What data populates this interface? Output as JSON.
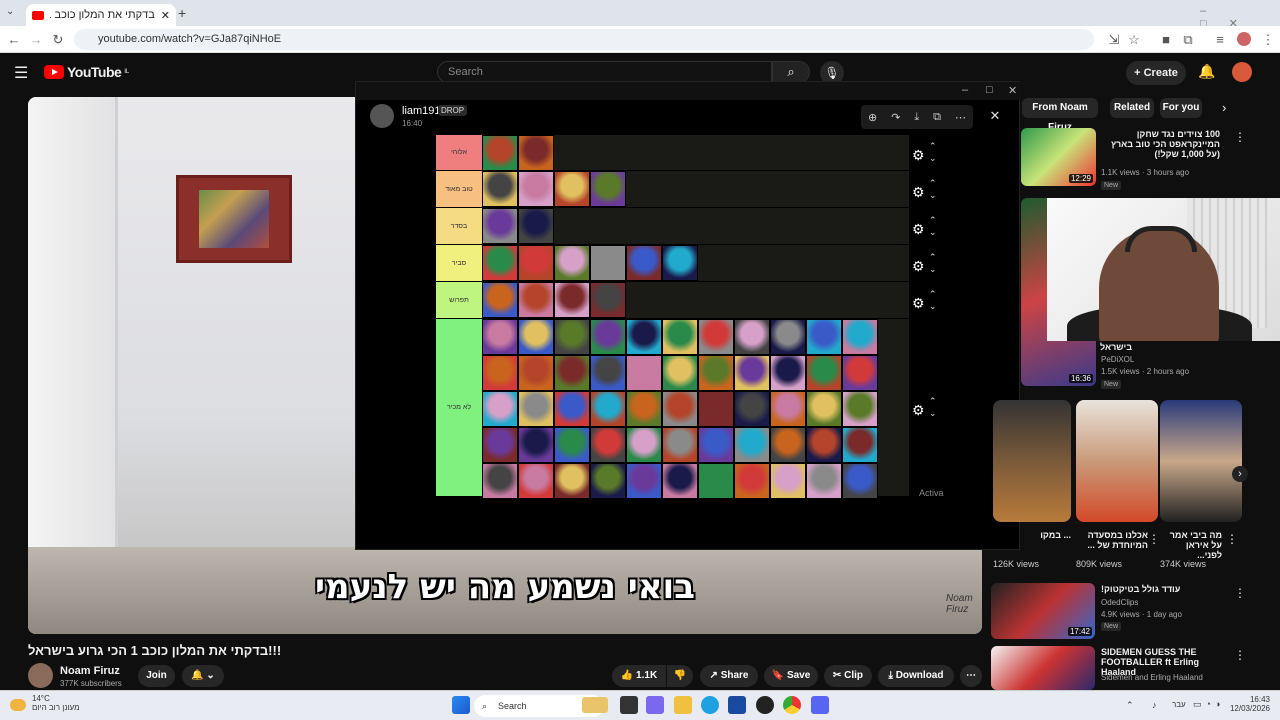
{
  "browser": {
    "tab_title": "בדקתי את המלון כוכב 1 הכי...",
    "url": "youtube.com/watch?v=GJa87qiNHoE"
  },
  "youtube": {
    "logo_text": "YouTube",
    "logo_region": "IL",
    "search_placeholder": "Search",
    "create_label": "Create"
  },
  "video": {
    "subtitle": "בואי נשמע מה יש לנעמי",
    "signature": "Noam Firuz",
    "title": "!!!בדקתי את המלון כוכב 1 הכי גרוע בישראל"
  },
  "channel": {
    "name": "Noam Firuz",
    "subscribers": "377K subscribers",
    "join_label": "Join"
  },
  "actions": {
    "likes": "1.1K",
    "share": "Share",
    "save": "Save",
    "clip": "Clip",
    "download": "Download"
  },
  "discord": {
    "username": "liam191",
    "badge": "DROP",
    "time": "16:40",
    "activation_text": "Activa"
  },
  "tiers": [
    {
      "label": "אלוהי",
      "color": "#ef7f7f",
      "count": 2
    },
    {
      "label": "טוב מאוד",
      "color": "#f7bf80",
      "count": 4
    },
    {
      "label": "בסדר",
      "color": "#f5dc82",
      "count": 2
    },
    {
      "label": "סביר",
      "color": "#f0f07f",
      "count": 6
    },
    {
      "label": "תפרוש",
      "color": "#bef57f",
      "count": 4
    },
    {
      "label": "לא מכיר",
      "color": "#80f07f",
      "count": 55
    }
  ],
  "sidebar": {
    "chips": [
      "From Noam Firuz",
      "Related",
      "For you"
    ],
    "recs": [
      {
        "title": "100 צוידים נגד שחקן המיינקראפט הכי טוב בארץ (על 1,000 שקל!)",
        "channel": "",
        "meta": "1.1K views · 3 hours ago",
        "badge": "New",
        "duration": "12:29"
      },
      {
        "title": "בישראל",
        "channel": "PeDiXOL",
        "meta": "1.5K views · 2 hours ago",
        "badge": "New",
        "duration": "16:36"
      },
      {
        "title": "עודד גולל בטיקטוק!",
        "channel": "OdedClips",
        "meta": "4.9K views · 1 day ago",
        "badge": "New",
        "duration": "17:42"
      },
      {
        "title": "SIDEMEN GUESS THE FOOTBALLER ft Erling Haaland",
        "channel": "Sidemen and Erling Haaland",
        "meta": "",
        "badge": "",
        "duration": ""
      }
    ],
    "shorts": [
      {
        "title": "... במקו",
        "views": "126K views"
      },
      {
        "title": "אכלנו במסעדה המיוחדת של ...",
        "views": "809K views"
      },
      {
        "title": "מה ביבי אמר על איראן לפני...",
        "views": "374K views"
      }
    ]
  },
  "taskbar": {
    "weather_temp": "14°C",
    "weather_desc": "מעונן רוב היום",
    "search_label": "Search",
    "lang": "עבר",
    "time": "16:43",
    "date": "12/03/2026"
  }
}
